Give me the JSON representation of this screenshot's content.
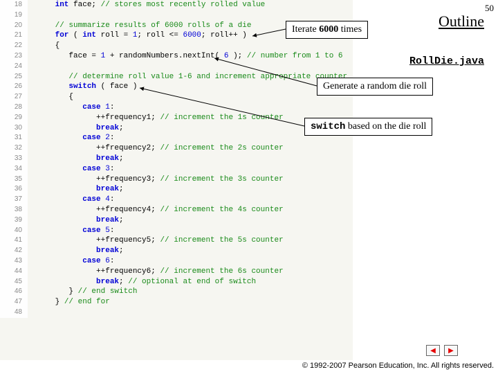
{
  "pageNumber": "50",
  "outline": "Outline",
  "fileName": "RollDie.java",
  "callout1": {
    "prefix": "Iterate ",
    "bold": "6000",
    "suffix": " times"
  },
  "callout2": "Generate a random die roll",
  "callout3": {
    "code": "switch",
    "rest": " based on the die roll"
  },
  "footer": "© 1992-2007 Pearson Education, Inc.  All rights reserved.",
  "code": {
    "startLine": 18,
    "lines": [
      {
        "tokens": [
          {
            "cls": "",
            "txt": "      "
          },
          {
            "cls": "kw",
            "txt": "int"
          },
          {
            "cls": "",
            "txt": " face; "
          },
          {
            "cls": "com",
            "txt": "// stores most recently rolled value"
          }
        ]
      },
      {
        "tokens": []
      },
      {
        "tokens": [
          {
            "cls": "",
            "txt": "      "
          },
          {
            "cls": "com",
            "txt": "// summarize results of 6000 rolls of a die"
          }
        ]
      },
      {
        "tokens": [
          {
            "cls": "",
            "txt": "      "
          },
          {
            "cls": "kw",
            "txt": "for"
          },
          {
            "cls": "",
            "txt": " ( "
          },
          {
            "cls": "kw",
            "txt": "int"
          },
          {
            "cls": "",
            "txt": " roll = "
          },
          {
            "cls": "num",
            "txt": "1"
          },
          {
            "cls": "",
            "txt": "; roll <= "
          },
          {
            "cls": "num",
            "txt": "6000"
          },
          {
            "cls": "",
            "txt": "; roll++ )"
          }
        ]
      },
      {
        "tokens": [
          {
            "cls": "",
            "txt": "      {"
          }
        ]
      },
      {
        "tokens": [
          {
            "cls": "",
            "txt": "         face = "
          },
          {
            "cls": "num",
            "txt": "1"
          },
          {
            "cls": "",
            "txt": " + randomNumbers.nextInt( "
          },
          {
            "cls": "num",
            "txt": "6"
          },
          {
            "cls": "",
            "txt": " ); "
          },
          {
            "cls": "com",
            "txt": "// number from 1 to 6"
          }
        ]
      },
      {
        "tokens": []
      },
      {
        "tokens": [
          {
            "cls": "",
            "txt": "         "
          },
          {
            "cls": "com",
            "txt": "// determine roll value 1-6 and increment appropriate counter"
          }
        ]
      },
      {
        "tokens": [
          {
            "cls": "",
            "txt": "         "
          },
          {
            "cls": "kw",
            "txt": "switch"
          },
          {
            "cls": "",
            "txt": " ( face )"
          }
        ]
      },
      {
        "tokens": [
          {
            "cls": "",
            "txt": "         {"
          }
        ]
      },
      {
        "tokens": [
          {
            "cls": "",
            "txt": "            "
          },
          {
            "cls": "kw",
            "txt": "case"
          },
          {
            "cls": "",
            "txt": " "
          },
          {
            "cls": "num",
            "txt": "1"
          },
          {
            "cls": "",
            "txt": ":"
          }
        ]
      },
      {
        "tokens": [
          {
            "cls": "",
            "txt": "               ++frequency1; "
          },
          {
            "cls": "com",
            "txt": "// increment the 1s counter"
          }
        ]
      },
      {
        "tokens": [
          {
            "cls": "",
            "txt": "               "
          },
          {
            "cls": "kw",
            "txt": "break"
          },
          {
            "cls": "",
            "txt": ";"
          }
        ]
      },
      {
        "tokens": [
          {
            "cls": "",
            "txt": "            "
          },
          {
            "cls": "kw",
            "txt": "case"
          },
          {
            "cls": "",
            "txt": " "
          },
          {
            "cls": "num",
            "txt": "2"
          },
          {
            "cls": "",
            "txt": ":"
          }
        ]
      },
      {
        "tokens": [
          {
            "cls": "",
            "txt": "               ++frequency2; "
          },
          {
            "cls": "com",
            "txt": "// increment the 2s counter"
          }
        ]
      },
      {
        "tokens": [
          {
            "cls": "",
            "txt": "               "
          },
          {
            "cls": "kw",
            "txt": "break"
          },
          {
            "cls": "",
            "txt": ";"
          }
        ]
      },
      {
        "tokens": [
          {
            "cls": "",
            "txt": "            "
          },
          {
            "cls": "kw",
            "txt": "case"
          },
          {
            "cls": "",
            "txt": " "
          },
          {
            "cls": "num",
            "txt": "3"
          },
          {
            "cls": "",
            "txt": ":"
          }
        ]
      },
      {
        "tokens": [
          {
            "cls": "",
            "txt": "               ++frequency3; "
          },
          {
            "cls": "com",
            "txt": "// increment the 3s counter"
          }
        ]
      },
      {
        "tokens": [
          {
            "cls": "",
            "txt": "               "
          },
          {
            "cls": "kw",
            "txt": "break"
          },
          {
            "cls": "",
            "txt": ";"
          }
        ]
      },
      {
        "tokens": [
          {
            "cls": "",
            "txt": "            "
          },
          {
            "cls": "kw",
            "txt": "case"
          },
          {
            "cls": "",
            "txt": " "
          },
          {
            "cls": "num",
            "txt": "4"
          },
          {
            "cls": "",
            "txt": ":"
          }
        ]
      },
      {
        "tokens": [
          {
            "cls": "",
            "txt": "               ++frequency4; "
          },
          {
            "cls": "com",
            "txt": "// increment the 4s counter"
          }
        ]
      },
      {
        "tokens": [
          {
            "cls": "",
            "txt": "               "
          },
          {
            "cls": "kw",
            "txt": "break"
          },
          {
            "cls": "",
            "txt": ";"
          }
        ]
      },
      {
        "tokens": [
          {
            "cls": "",
            "txt": "            "
          },
          {
            "cls": "kw",
            "txt": "case"
          },
          {
            "cls": "",
            "txt": " "
          },
          {
            "cls": "num",
            "txt": "5"
          },
          {
            "cls": "",
            "txt": ":"
          }
        ]
      },
      {
        "tokens": [
          {
            "cls": "",
            "txt": "               ++frequency5; "
          },
          {
            "cls": "com",
            "txt": "// increment the 5s counter"
          }
        ]
      },
      {
        "tokens": [
          {
            "cls": "",
            "txt": "               "
          },
          {
            "cls": "kw",
            "txt": "break"
          },
          {
            "cls": "",
            "txt": ";"
          }
        ]
      },
      {
        "tokens": [
          {
            "cls": "",
            "txt": "            "
          },
          {
            "cls": "kw",
            "txt": "case"
          },
          {
            "cls": "",
            "txt": " "
          },
          {
            "cls": "num",
            "txt": "6"
          },
          {
            "cls": "",
            "txt": ":"
          }
        ]
      },
      {
        "tokens": [
          {
            "cls": "",
            "txt": "               ++frequency6; "
          },
          {
            "cls": "com",
            "txt": "// increment the 6s counter"
          }
        ]
      },
      {
        "tokens": [
          {
            "cls": "",
            "txt": "               "
          },
          {
            "cls": "kw",
            "txt": "break"
          },
          {
            "cls": "",
            "txt": "; "
          },
          {
            "cls": "com",
            "txt": "// optional at end of switch"
          }
        ]
      },
      {
        "tokens": [
          {
            "cls": "",
            "txt": "         } "
          },
          {
            "cls": "com",
            "txt": "// end switch"
          }
        ]
      },
      {
        "tokens": [
          {
            "cls": "",
            "txt": "      } "
          },
          {
            "cls": "com",
            "txt": "// end for"
          }
        ]
      },
      {
        "tokens": []
      }
    ]
  }
}
